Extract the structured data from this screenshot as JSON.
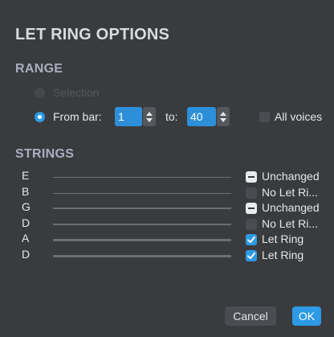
{
  "dialog": {
    "title": "LET RING OPTIONS",
    "range": {
      "heading": "RANGE",
      "selection_label": "Selection",
      "from_bar_label": "From bar:",
      "from_value": "1",
      "to_label": "to:",
      "to_value": "40",
      "all_voices_label": "All voices",
      "selected_option": "From bar",
      "all_voices_checked": false
    },
    "strings": {
      "heading": "STRINGS",
      "rows": [
        {
          "name": "E",
          "state": "indeterminate",
          "label": "Unchanged"
        },
        {
          "name": "B",
          "state": "unchecked",
          "label": "No Let Ri..."
        },
        {
          "name": "G",
          "state": "indeterminate",
          "label": "Unchanged"
        },
        {
          "name": "D",
          "state": "unchecked",
          "label": "No Let Ri..."
        },
        {
          "name": "A",
          "state": "checked",
          "label": "Let Ring"
        },
        {
          "name": "D",
          "state": "checked",
          "label": "Let Ring"
        }
      ]
    },
    "buttons": {
      "cancel_label": "Cancel",
      "ok_label": "OK"
    }
  },
  "colors": {
    "background": "#3a3b3e",
    "accent": "#2e9ae5",
    "section_heading": "#a9afbf"
  }
}
